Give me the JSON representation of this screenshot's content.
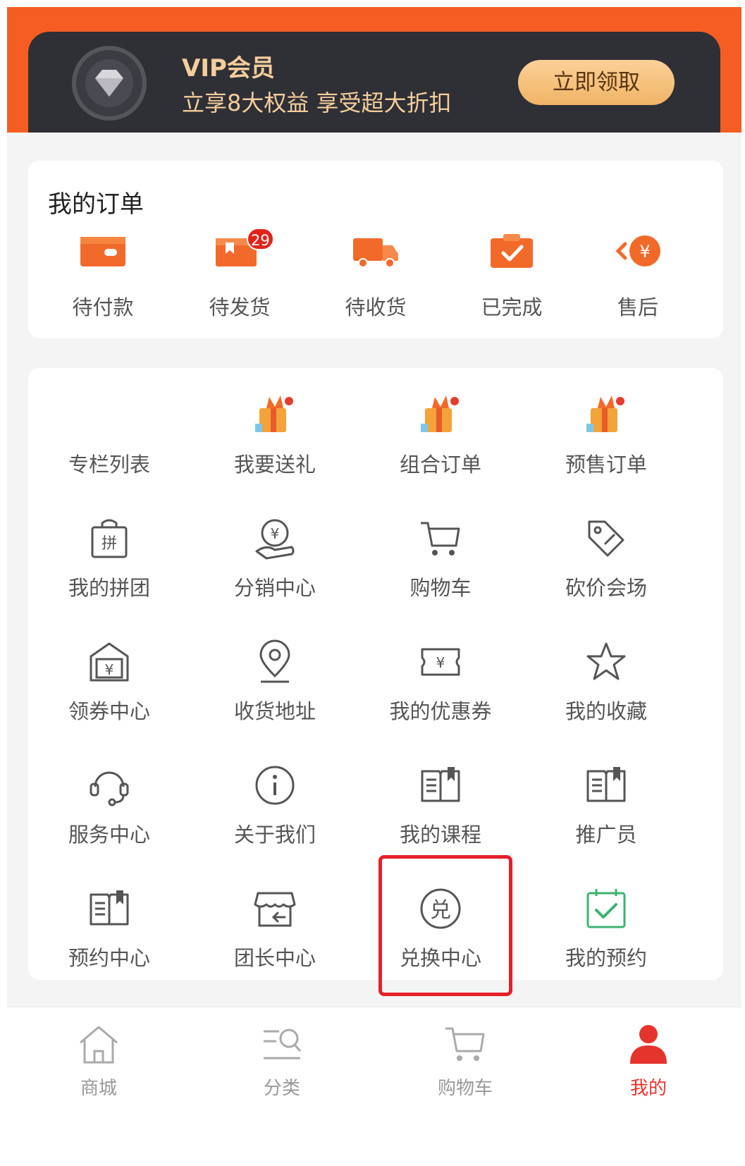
{
  "vip": {
    "title": "VIP会员",
    "subtitle": "立享8大权益 享受超大折扣",
    "button": "立即领取",
    "icon": "diamond-medal-icon"
  },
  "orders": {
    "title": "我的订单",
    "items": [
      {
        "label": "待付款",
        "icon": "wallet-icon"
      },
      {
        "label": "待发货",
        "icon": "package-ship-icon",
        "badge": "29"
      },
      {
        "label": "待收货",
        "icon": "delivery-truck-icon"
      },
      {
        "label": "已完成",
        "icon": "check-box-icon"
      },
      {
        "label": "售后",
        "icon": "refund-yuan-icon"
      }
    ]
  },
  "services": {
    "items": [
      {
        "label": "专栏列表",
        "icon": "none"
      },
      {
        "label": "我要送礼",
        "icon": "gift-icon"
      },
      {
        "label": "组合订单",
        "icon": "gift-icon"
      },
      {
        "label": "预售订单",
        "icon": "gift-icon"
      },
      {
        "label": "我的拼团",
        "icon": "group-buy-bag-icon"
      },
      {
        "label": "分销中心",
        "icon": "hand-coin-icon"
      },
      {
        "label": "购物车",
        "icon": "cart-icon"
      },
      {
        "label": "砍价会场",
        "icon": "price-tag-icon"
      },
      {
        "label": "领券中心",
        "icon": "coupon-envelope-icon"
      },
      {
        "label": "收货地址",
        "icon": "location-pin-icon"
      },
      {
        "label": "我的优惠券",
        "icon": "ticket-icon"
      },
      {
        "label": "我的收藏",
        "icon": "star-icon"
      },
      {
        "label": "服务中心",
        "icon": "headset-icon"
      },
      {
        "label": "关于我们",
        "icon": "info-circle-icon"
      },
      {
        "label": "我的课程",
        "icon": "book-icon"
      },
      {
        "label": "推广员",
        "icon": "book-icon"
      },
      {
        "label": "预约中心",
        "icon": "book-icon"
      },
      {
        "label": "团长中心",
        "icon": "storefront-icon"
      },
      {
        "label": "兑换中心",
        "icon": "exchange-circle-icon"
      },
      {
        "label": "我的预约",
        "icon": "calendar-check-icon"
      }
    ]
  },
  "tabbar": {
    "items": [
      {
        "label": "商城",
        "icon": "home-icon",
        "active": false
      },
      {
        "label": "分类",
        "icon": "category-search-icon",
        "active": false
      },
      {
        "label": "购物车",
        "icon": "cart-icon",
        "active": false
      },
      {
        "label": "我的",
        "icon": "user-icon",
        "active": true
      }
    ]
  },
  "colors": {
    "brand": "#f55d22",
    "vip_dark": "#2f2f36",
    "vip_gold": "#f4ce9c",
    "badge_red": "#e0231b",
    "highlight_red": "#e4202a",
    "active_tab": "#e4342c",
    "icon_gray": "#555555",
    "icon_green": "#3cb371"
  }
}
